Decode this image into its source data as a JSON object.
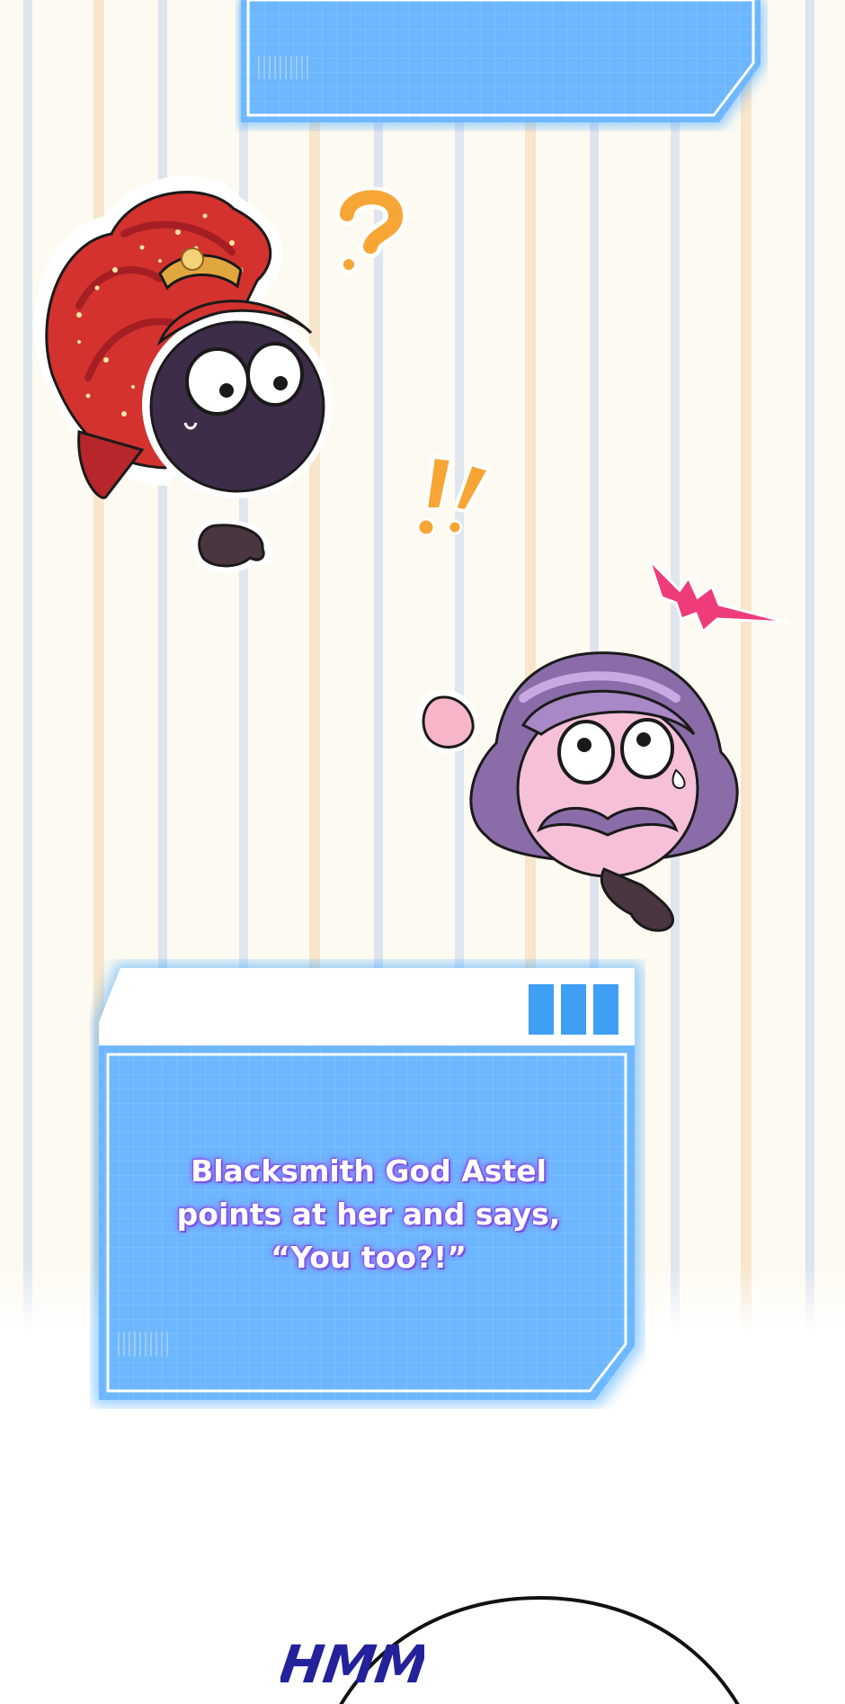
{
  "caption": {
    "line1": "Blacksmith God Astel",
    "line2": "points at her and says,",
    "line3": "“You too?!”"
  },
  "sfx": {
    "hmm": "HMM",
    "question": "?",
    "exclaim": "!!"
  },
  "icons": {
    "surprise_mark": "surprise-spark-icon"
  },
  "colors": {
    "panel_blue": "#6cb7ff",
    "panel_glow": "#41a6ff",
    "caption_outline": "#7f56e6",
    "sfx_orange": "#f7a535",
    "hmm_ink": "#23229a",
    "spark_pink": "#ee3c7a"
  }
}
